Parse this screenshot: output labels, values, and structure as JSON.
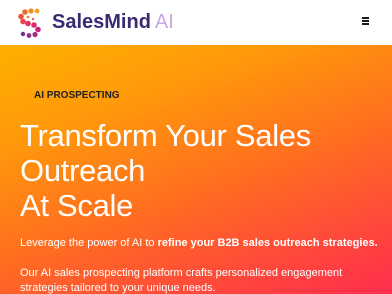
{
  "header": {
    "brand_name": "SalesMind",
    "brand_suffix": "AI",
    "logo_icon": "s-dots-logo-icon",
    "menu_icon": "hamburger-menu-icon"
  },
  "hero": {
    "eyebrow": "AI PROSPECTING",
    "headline": [
      "Transform Your Sales",
      "Outreach",
      "At Scale"
    ],
    "lead_prefix": "Leverage the power of AI to ",
    "lead_bold": "refine your B2B sales outreach strategies.",
    "description": "Our AI sales prospecting platform crafts personalized engagement strategies tailored to your unique needs."
  },
  "colors": {
    "brand_primary": "#3a2a74",
    "brand_ai": "#c7a7e4",
    "gradient_start": "#ffb000",
    "gradient_end": "#ff2d4e"
  }
}
